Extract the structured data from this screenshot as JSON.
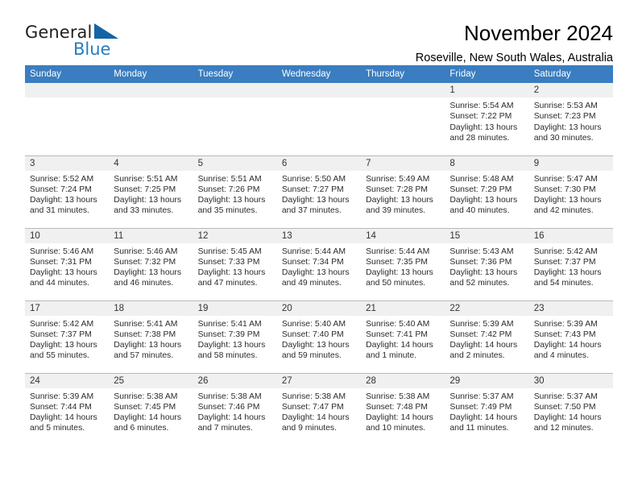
{
  "logo": {
    "word_one": "General",
    "word_two": "Blue",
    "triangle_color": "#1464a5"
  },
  "header": {
    "title": "November 2024",
    "location": "Roseville, New South Wales, Australia"
  },
  "theme": {
    "header_blue": "#3a7dc0",
    "daynum_band": "#f0f0f0",
    "grid_line": "#b9b9b9"
  },
  "weekday_headers": [
    "Sunday",
    "Monday",
    "Tuesday",
    "Wednesday",
    "Thursday",
    "Friday",
    "Saturday"
  ],
  "weeks": [
    [
      {
        "day": "",
        "blank": true
      },
      {
        "day": "",
        "blank": true
      },
      {
        "day": "",
        "blank": true
      },
      {
        "day": "",
        "blank": true
      },
      {
        "day": "",
        "blank": true
      },
      {
        "day": "1",
        "sunrise": "Sunrise: 5:54 AM",
        "sunset": "Sunset: 7:22 PM",
        "daylight": "Daylight: 13 hours and 28 minutes."
      },
      {
        "day": "2",
        "sunrise": "Sunrise: 5:53 AM",
        "sunset": "Sunset: 7:23 PM",
        "daylight": "Daylight: 13 hours and 30 minutes."
      }
    ],
    [
      {
        "day": "3",
        "sunrise": "Sunrise: 5:52 AM",
        "sunset": "Sunset: 7:24 PM",
        "daylight": "Daylight: 13 hours and 31 minutes."
      },
      {
        "day": "4",
        "sunrise": "Sunrise: 5:51 AM",
        "sunset": "Sunset: 7:25 PM",
        "daylight": "Daylight: 13 hours and 33 minutes."
      },
      {
        "day": "5",
        "sunrise": "Sunrise: 5:51 AM",
        "sunset": "Sunset: 7:26 PM",
        "daylight": "Daylight: 13 hours and 35 minutes."
      },
      {
        "day": "6",
        "sunrise": "Sunrise: 5:50 AM",
        "sunset": "Sunset: 7:27 PM",
        "daylight": "Daylight: 13 hours and 37 minutes."
      },
      {
        "day": "7",
        "sunrise": "Sunrise: 5:49 AM",
        "sunset": "Sunset: 7:28 PM",
        "daylight": "Daylight: 13 hours and 39 minutes."
      },
      {
        "day": "8",
        "sunrise": "Sunrise: 5:48 AM",
        "sunset": "Sunset: 7:29 PM",
        "daylight": "Daylight: 13 hours and 40 minutes."
      },
      {
        "day": "9",
        "sunrise": "Sunrise: 5:47 AM",
        "sunset": "Sunset: 7:30 PM",
        "daylight": "Daylight: 13 hours and 42 minutes."
      }
    ],
    [
      {
        "day": "10",
        "sunrise": "Sunrise: 5:46 AM",
        "sunset": "Sunset: 7:31 PM",
        "daylight": "Daylight: 13 hours and 44 minutes."
      },
      {
        "day": "11",
        "sunrise": "Sunrise: 5:46 AM",
        "sunset": "Sunset: 7:32 PM",
        "daylight": "Daylight: 13 hours and 46 minutes."
      },
      {
        "day": "12",
        "sunrise": "Sunrise: 5:45 AM",
        "sunset": "Sunset: 7:33 PM",
        "daylight": "Daylight: 13 hours and 47 minutes."
      },
      {
        "day": "13",
        "sunrise": "Sunrise: 5:44 AM",
        "sunset": "Sunset: 7:34 PM",
        "daylight": "Daylight: 13 hours and 49 minutes."
      },
      {
        "day": "14",
        "sunrise": "Sunrise: 5:44 AM",
        "sunset": "Sunset: 7:35 PM",
        "daylight": "Daylight: 13 hours and 50 minutes."
      },
      {
        "day": "15",
        "sunrise": "Sunrise: 5:43 AM",
        "sunset": "Sunset: 7:36 PM",
        "daylight": "Daylight: 13 hours and 52 minutes."
      },
      {
        "day": "16",
        "sunrise": "Sunrise: 5:42 AM",
        "sunset": "Sunset: 7:37 PM",
        "daylight": "Daylight: 13 hours and 54 minutes."
      }
    ],
    [
      {
        "day": "17",
        "sunrise": "Sunrise: 5:42 AM",
        "sunset": "Sunset: 7:37 PM",
        "daylight": "Daylight: 13 hours and 55 minutes."
      },
      {
        "day": "18",
        "sunrise": "Sunrise: 5:41 AM",
        "sunset": "Sunset: 7:38 PM",
        "daylight": "Daylight: 13 hours and 57 minutes."
      },
      {
        "day": "19",
        "sunrise": "Sunrise: 5:41 AM",
        "sunset": "Sunset: 7:39 PM",
        "daylight": "Daylight: 13 hours and 58 minutes."
      },
      {
        "day": "20",
        "sunrise": "Sunrise: 5:40 AM",
        "sunset": "Sunset: 7:40 PM",
        "daylight": "Daylight: 13 hours and 59 minutes."
      },
      {
        "day": "21",
        "sunrise": "Sunrise: 5:40 AM",
        "sunset": "Sunset: 7:41 PM",
        "daylight": "Daylight: 14 hours and 1 minute."
      },
      {
        "day": "22",
        "sunrise": "Sunrise: 5:39 AM",
        "sunset": "Sunset: 7:42 PM",
        "daylight": "Daylight: 14 hours and 2 minutes."
      },
      {
        "day": "23",
        "sunrise": "Sunrise: 5:39 AM",
        "sunset": "Sunset: 7:43 PM",
        "daylight": "Daylight: 14 hours and 4 minutes."
      }
    ],
    [
      {
        "day": "24",
        "sunrise": "Sunrise: 5:39 AM",
        "sunset": "Sunset: 7:44 PM",
        "daylight": "Daylight: 14 hours and 5 minutes."
      },
      {
        "day": "25",
        "sunrise": "Sunrise: 5:38 AM",
        "sunset": "Sunset: 7:45 PM",
        "daylight": "Daylight: 14 hours and 6 minutes."
      },
      {
        "day": "26",
        "sunrise": "Sunrise: 5:38 AM",
        "sunset": "Sunset: 7:46 PM",
        "daylight": "Daylight: 14 hours and 7 minutes."
      },
      {
        "day": "27",
        "sunrise": "Sunrise: 5:38 AM",
        "sunset": "Sunset: 7:47 PM",
        "daylight": "Daylight: 14 hours and 9 minutes."
      },
      {
        "day": "28",
        "sunrise": "Sunrise: 5:38 AM",
        "sunset": "Sunset: 7:48 PM",
        "daylight": "Daylight: 14 hours and 10 minutes."
      },
      {
        "day": "29",
        "sunrise": "Sunrise: 5:37 AM",
        "sunset": "Sunset: 7:49 PM",
        "daylight": "Daylight: 14 hours and 11 minutes."
      },
      {
        "day": "30",
        "sunrise": "Sunrise: 5:37 AM",
        "sunset": "Sunset: 7:50 PM",
        "daylight": "Daylight: 14 hours and 12 minutes."
      }
    ]
  ]
}
